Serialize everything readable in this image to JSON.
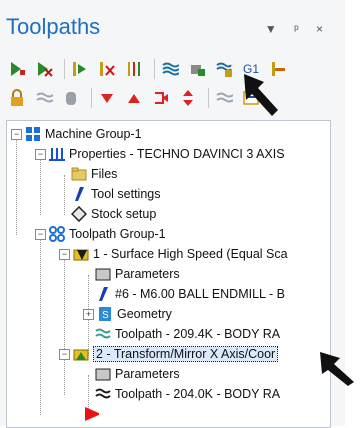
{
  "panel": {
    "title": "Toolpaths",
    "dropdown_glyph": "▼",
    "pin_glyph": "ᵖ",
    "close_glyph": "×"
  },
  "toolbar1": [
    {
      "icon": "select-all-icon"
    },
    {
      "icon": "deselect-icon"
    },
    {
      "icon": "regenerate-icon"
    },
    {
      "icon": "regenerate-dirty-icon"
    },
    {
      "icon": "toggle-display-icon"
    },
    {
      "icon": "backplot-icon"
    },
    {
      "icon": "verify-icon"
    },
    {
      "icon": "post-icon"
    },
    {
      "icon": "g1-icon",
      "label": "G1"
    },
    {
      "icon": "goto-icon"
    }
  ],
  "toolbar2": [
    {
      "icon": "lock-icon"
    },
    {
      "icon": "toolpath-display-icon"
    },
    {
      "icon": "post-toggle-icon"
    },
    {
      "icon": "move-down-icon"
    },
    {
      "icon": "move-up-icon"
    },
    {
      "icon": "insert-arrow-icon"
    },
    {
      "icon": "scroll-icon"
    },
    {
      "icon": "expand-icon"
    },
    {
      "icon": "options-icon"
    }
  ],
  "tree": {
    "machine_group": "Machine Group-1",
    "properties": "Properties - TECHNO DAVINCI 3 AXIS",
    "files": "Files",
    "tool_settings": "Tool settings",
    "stock_setup": "Stock setup",
    "toolpath_group": "Toolpath Group-1",
    "op1": "1 - Surface High Speed (Equal Sca",
    "op1_parameters": "Parameters",
    "op1_tool": "#6 - M6.00 BALL ENDMILL - B",
    "op1_geometry": "Geometry",
    "op1_toolpath": "Toolpath - 209.4K - BODY RA",
    "op2": "2 - Transform/Mirror X Axis/Coor",
    "op2_parameters": "Parameters",
    "op2_toolpath": "Toolpath - 204.0K - BODY RA"
  }
}
